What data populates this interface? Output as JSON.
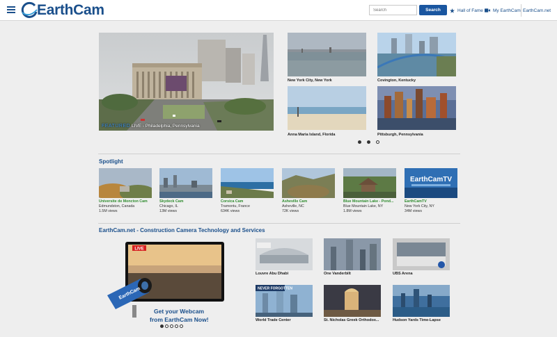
{
  "header": {
    "logo_text": "EarthCam",
    "search_placeholder": "Search",
    "search_button": "Search",
    "links": [
      {
        "label": "Hall of Fame",
        "icon": "star-icon"
      },
      {
        "label": "My EarthCam",
        "icon": "video-camera-icon"
      },
      {
        "label": "EarthCam.net",
        "icon": ""
      }
    ]
  },
  "featured": {
    "main": {
      "tag": "FEATURED",
      "caption": "LIVE - Philadelphia, Pennsylvania"
    },
    "tiles": [
      {
        "label": "New York City, New York"
      },
      {
        "label": "Covington, Kentucky"
      },
      {
        "label": "Anna Maria Island, Florida"
      },
      {
        "label": "Pittsburgh, Pennsylvania"
      }
    ],
    "carousel_pages": 3,
    "carousel_active": [
      0,
      1
    ]
  },
  "spotlight": {
    "title": "Spotlight",
    "cards": [
      {
        "name": "Universite de Moncton Cam",
        "location": "Edmundston, Canada",
        "views": "1.5M views"
      },
      {
        "name": "Skydeck Cam",
        "location": "Chicago, IL",
        "views": "13M views"
      },
      {
        "name": "Corsica Cam",
        "location": "Tramontu, France",
        "views": "634K views"
      },
      {
        "name": "Asheville Cam",
        "location": "Asheville, NC",
        "views": "72K views"
      },
      {
        "name": "Blue Mountain Lake - Pond...",
        "location": "Blue Mountain Lake, NY",
        "views": "1.8M views"
      },
      {
        "name": "EarthCamTV",
        "location": "New York City, NY",
        "views": "34M views"
      }
    ]
  },
  "construction": {
    "title": "EarthCam.net - Construction Camera Technology and Services",
    "promo": {
      "live_badge": "LIVE",
      "brand": "EarthCam",
      "line1": "Get your Webcam",
      "line2": "from EarthCam Now!",
      "pages": 5,
      "active_page": 0
    },
    "tiles": [
      {
        "label": "Louvre Abu Dhabi"
      },
      {
        "label": "One Vanderbilt"
      },
      {
        "label": "UBS Arena"
      },
      {
        "label": "World Trade Center",
        "overlay": "NEVER FORGOTTEN"
      },
      {
        "label": "St. Nicholas Greek Orthodox..."
      },
      {
        "label": "Hudson Yards Time-Lapse"
      }
    ]
  },
  "colors": {
    "brand": "#1a4f8b",
    "accent": "#1a56a0",
    "spotlight_name": "#2e8b2e"
  }
}
